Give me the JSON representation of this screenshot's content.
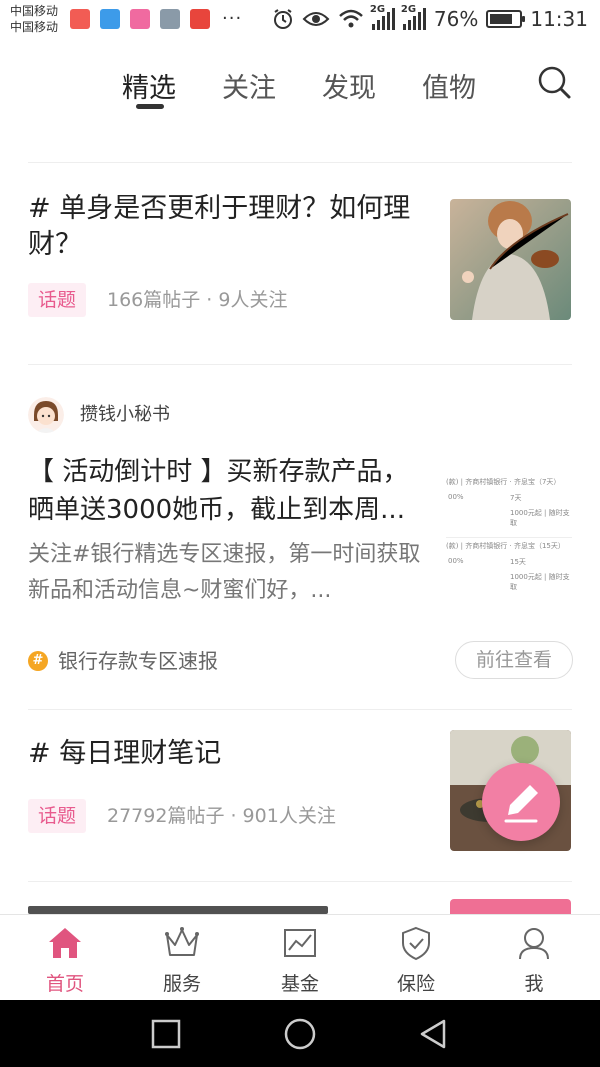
{
  "status_bar": {
    "carrier_1": "中国移动",
    "carrier_2": "中国移动",
    "more": "···",
    "network_1": "2G",
    "network_2": "2G",
    "battery": "76%",
    "battery_level": 0.76,
    "time": "11:31"
  },
  "top_tabs": [
    {
      "label": "精选",
      "active": true
    },
    {
      "label": "关注",
      "active": false
    },
    {
      "label": "发现",
      "active": false
    },
    {
      "label": "值物",
      "active": false
    }
  ],
  "feed": {
    "topic_1": {
      "title": "# 单身是否更利于理财？如何理财？",
      "tag": "话题",
      "meta": "166篇帖子 · 9人关注"
    },
    "post_1": {
      "author": "攒钱小秘书",
      "title": "【 活动倒计时 】买新存款产品，晒单送3000她币，截止到本周...",
      "desc": "关注#银行精选专区速报，第一时间获取新品和活动信息~财蜜们好，...",
      "thumb_rows": [
        {
          "header": "(款) | 齐商村镇银行 · 齐息宝（7天）",
          "rate": "00%",
          "term": "7天",
          "detail": "1000元起 | 随时支取"
        },
        {
          "header": "(款) | 齐商村镇银行 · 齐息宝（15天）",
          "rate": "00%",
          "term": "15天",
          "detail": "1000元起 | 随时支取"
        }
      ],
      "channel": "银行存款专区速报",
      "goto": "前往查看"
    },
    "topic_2": {
      "title": "# 每日理财笔记",
      "tag": "话题",
      "meta": "27792篇帖子 · 901人关注"
    }
  },
  "bottom_nav": [
    {
      "label": "首页",
      "icon": "home-icon",
      "active": true
    },
    {
      "label": "服务",
      "icon": "crown-icon",
      "active": false
    },
    {
      "label": "基金",
      "icon": "chart-icon",
      "active": false
    },
    {
      "label": "保险",
      "icon": "shield-icon",
      "active": false
    },
    {
      "label": "我",
      "icon": "user-icon",
      "active": false
    }
  ],
  "colors": {
    "accent": "#e0557f",
    "tag_bg": "#fdeef4",
    "fab": "#f27fa4",
    "channel_icon": "#f5a623"
  }
}
